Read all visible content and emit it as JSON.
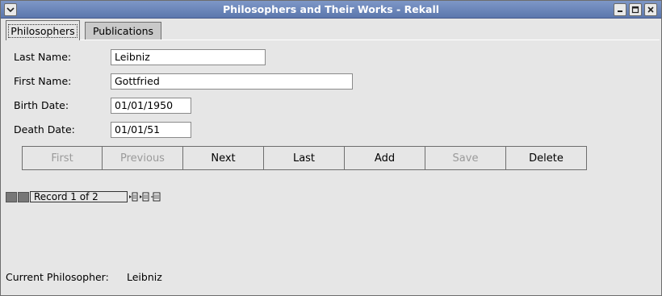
{
  "window": {
    "title": "Philosophers and Their Works - Rekall",
    "menu_icon": "chevron-down-icon",
    "controls": [
      "minimize-icon",
      "maximize-icon",
      "close-icon"
    ]
  },
  "tabs": [
    {
      "label": "Philosophers",
      "active": true
    },
    {
      "label": "Publications",
      "active": false
    }
  ],
  "form": {
    "last_name_label": "Last Name:",
    "last_name_value": "Leibniz",
    "first_name_label": "First Name:",
    "first_name_value": "Gottfried",
    "birth_date_label": "Birth Date:",
    "birth_date_value": "01/01/1950",
    "death_date_label": "Death Date:",
    "death_date_value": "01/01/51"
  },
  "buttons": {
    "first": "First",
    "previous": "Previous",
    "next": "Next",
    "last": "Last",
    "add": "Add",
    "save": "Save",
    "delete": "Delete"
  },
  "record_nav": {
    "text": "Record 1 of 2"
  },
  "footer": {
    "current_label": "Current Philosopher:",
    "current_value": "Leibniz"
  },
  "colors": {
    "titlebar": "#5b77ad",
    "background": "#e6e6e6",
    "disabled_text": "#9a9a9a"
  }
}
